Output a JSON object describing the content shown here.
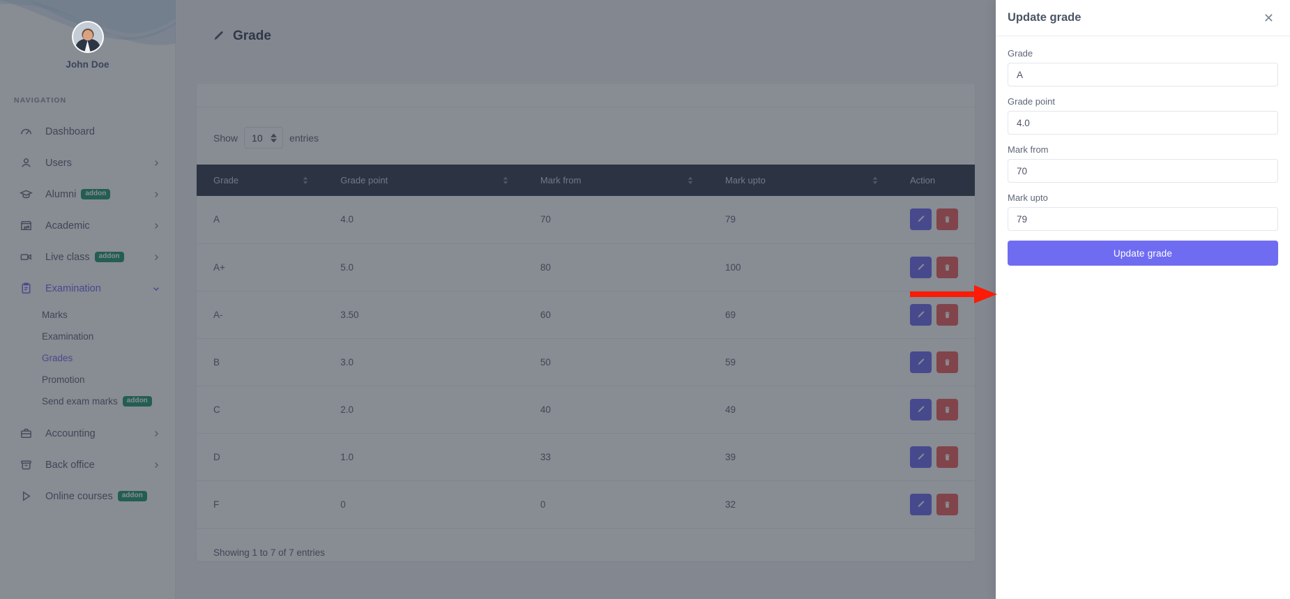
{
  "sidebar": {
    "profile_name": "John Doe",
    "nav_heading": "NAVIGATION",
    "items": [
      {
        "label": "Dashboard",
        "icon": "gauge-icon",
        "addon": "",
        "caret": ""
      },
      {
        "label": "Users",
        "icon": "user-icon",
        "addon": "",
        "caret": "›"
      },
      {
        "label": "Alumni",
        "icon": "graduation-icon",
        "addon": "addon",
        "caret": "›"
      },
      {
        "label": "Academic",
        "icon": "store-icon",
        "addon": "",
        "caret": "›"
      },
      {
        "label": "Live class",
        "icon": "video-icon",
        "addon": "addon",
        "caret": "›"
      },
      {
        "label": "Examination",
        "icon": "clipboard-icon",
        "addon": "",
        "caret": "⌄"
      }
    ],
    "sub_items": [
      {
        "label": "Marks",
        "addon": ""
      },
      {
        "label": "Examination",
        "addon": ""
      },
      {
        "label": "Grades",
        "addon": ""
      },
      {
        "label": "Promotion",
        "addon": ""
      },
      {
        "label": "Send exam marks",
        "addon": "addon"
      }
    ],
    "items_after": [
      {
        "label": "Accounting",
        "icon": "briefcase-icon",
        "addon": "",
        "caret": "›"
      },
      {
        "label": "Back office",
        "icon": "archive-icon",
        "addon": "",
        "caret": "›"
      },
      {
        "label": "Online courses",
        "icon": "play-icon",
        "addon": "addon",
        "caret": ""
      }
    ]
  },
  "page": {
    "title": "Grade",
    "title_icon": "pencil-icon"
  },
  "datatable": {
    "show_label": "Show",
    "entries_label": "entries",
    "page_length": "10",
    "columns": [
      "Grade",
      "Grade point",
      "Mark from",
      "Mark upto",
      "Action"
    ],
    "rows": [
      {
        "grade": "A",
        "grade_point": "4.0",
        "mark_from": "70",
        "mark_upto": "79"
      },
      {
        "grade": "A+",
        "grade_point": "5.0",
        "mark_from": "80",
        "mark_upto": "100"
      },
      {
        "grade": "A-",
        "grade_point": "3.50",
        "mark_from": "60",
        "mark_upto": "69"
      },
      {
        "grade": "B",
        "grade_point": "3.0",
        "mark_from": "50",
        "mark_upto": "59"
      },
      {
        "grade": "C",
        "grade_point": "2.0",
        "mark_from": "40",
        "mark_upto": "49"
      },
      {
        "grade": "D",
        "grade_point": "1.0",
        "mark_from": "33",
        "mark_upto": "39"
      },
      {
        "grade": "F",
        "grade_point": "0",
        "mark_from": "0",
        "mark_upto": "32"
      }
    ],
    "info": "Showing 1 to 7 of 7 entries"
  },
  "drawer": {
    "title": "Update grade",
    "close_icon": "close-icon",
    "fields": [
      {
        "label": "Grade",
        "value": "A"
      },
      {
        "label": "Grade point",
        "value": "4.0"
      },
      {
        "label": "Mark from",
        "value": "70"
      },
      {
        "label": "Mark upto",
        "value": "79"
      }
    ],
    "submit_label": "Update grade"
  },
  "colors": {
    "accent": "#6f6cf2",
    "addon_badge": "#1f9a72",
    "table_header": "#333d50",
    "danger": "#ef5f5f",
    "annotation_arrow": "#fc1b06"
  }
}
